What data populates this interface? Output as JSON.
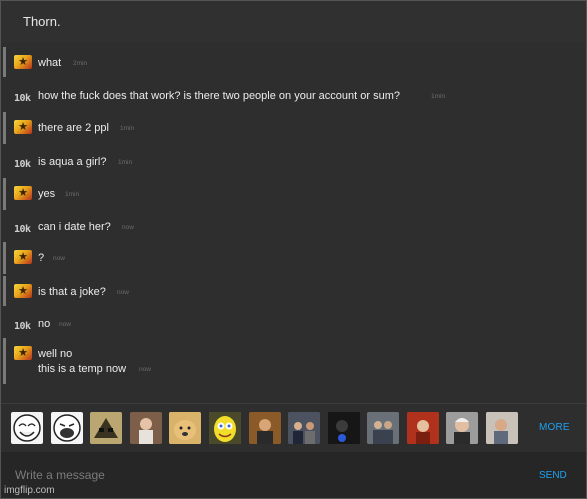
{
  "header": {
    "title": "Thorn."
  },
  "messages": [
    {
      "sender": "me",
      "avatar": "star-badge-icon",
      "lines": [
        "what"
      ],
      "time": "2min"
    },
    {
      "sender": "other",
      "avatar": "10k",
      "lines": [
        "how the fuck does that work? is there two people on your account or sum?"
      ],
      "time": "1min"
    },
    {
      "sender": "me",
      "avatar": "star-badge-icon",
      "lines": [
        "there are 2 ppl"
      ],
      "time": "1min"
    },
    {
      "sender": "other",
      "avatar": "10k",
      "lines": [
        "is aqua a girl?"
      ],
      "time": "1min"
    },
    {
      "sender": "me",
      "avatar": "star-badge-icon",
      "lines": [
        "yes"
      ],
      "time": "1min"
    },
    {
      "sender": "other",
      "avatar": "10k",
      "lines": [
        "can i date her?"
      ],
      "time": "now"
    },
    {
      "sender": "me",
      "avatar": "star-badge-icon",
      "lines": [
        "?"
      ],
      "time": "now"
    },
    {
      "sender": "me",
      "avatar": "star-badge-icon",
      "lines": [
        "is that a joke?"
      ],
      "time": "now"
    },
    {
      "sender": "other",
      "avatar": "10k",
      "lines": [
        "no"
      ],
      "time": "now"
    },
    {
      "sender": "me",
      "avatar": "star-badge-icon",
      "lines": [
        "well no",
        "this is a temp now"
      ],
      "time": "now"
    }
  ],
  "emoji_bar": {
    "items": [
      "troll-face-emoji-icon",
      "lol-face-emoji-icon",
      "sunglasses-emoji-icon",
      "woman-photo-emoji-icon",
      "doge-emoji-icon",
      "spongebob-emoji-icon",
      "man-photo-emoji-icon",
      "crowd-photo-emoji-icon",
      "dark-photo-emoji-icon",
      "group-photo-emoji-icon",
      "red-photo-emoji-icon",
      "old-man-emoji-icon",
      "person-photo-emoji-icon"
    ],
    "more_label": "MORE"
  },
  "compose": {
    "placeholder": "Write a message",
    "send_label": "SEND"
  },
  "watermark": "imgflip.com",
  "colors": {
    "accent": "#1da1f2",
    "background": "#2e2e2e",
    "me_marker": "#7a7a7a"
  }
}
